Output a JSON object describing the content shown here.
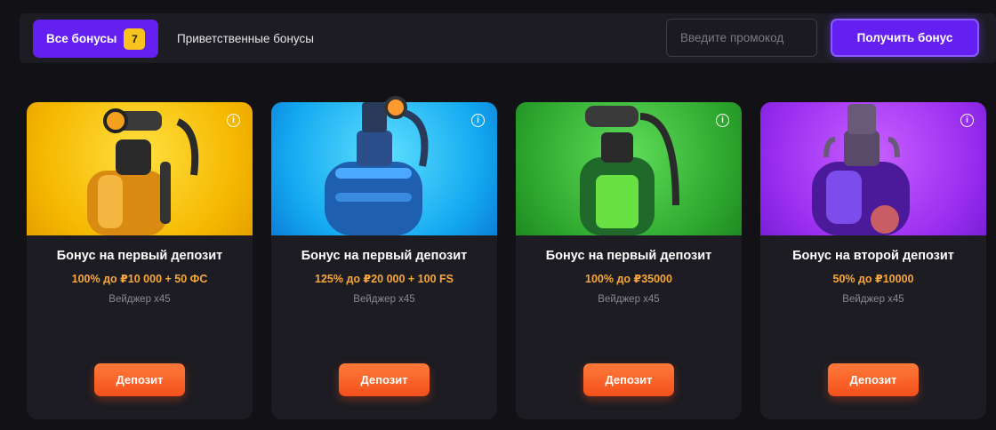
{
  "topbar": {
    "tab_all_label": "Все бонусы",
    "tab_all_count": "7",
    "tab_welcome_label": "Приветственные бонусы",
    "promo_placeholder": "Введите промокод",
    "get_bonus_label": "Получить бонус"
  },
  "colors": {
    "accent": "#6420f0",
    "badge": "#f9c31d",
    "offer": "#f7a73a",
    "deposit": "#f4501c"
  },
  "cards": [
    {
      "title": "Бонус на первый депозит",
      "offer": "100% до ₽10 000 + 50 ФС",
      "wager": "Вейджер x45",
      "button": "Депозит",
      "info": "i",
      "image": "yellow-gas-tank"
    },
    {
      "title": "Бонус на первый депозит",
      "offer": "125% до ₽20 000 + 100 FS",
      "wager": "Вейджер x45",
      "button": "Депозит",
      "info": "i",
      "image": "blue-gas-tank"
    },
    {
      "title": "Бонус на первый депозит",
      "offer": "100% до ₽35000",
      "wager": "Вейджер x45",
      "button": "Депозит",
      "info": "i",
      "image": "green-gas-tank"
    },
    {
      "title": "Бонус на второй депозит",
      "offer": "50% до ₽10000",
      "wager": "Вейджер x45",
      "button": "Депозит",
      "info": "i",
      "image": "purple-gas-tank"
    }
  ]
}
